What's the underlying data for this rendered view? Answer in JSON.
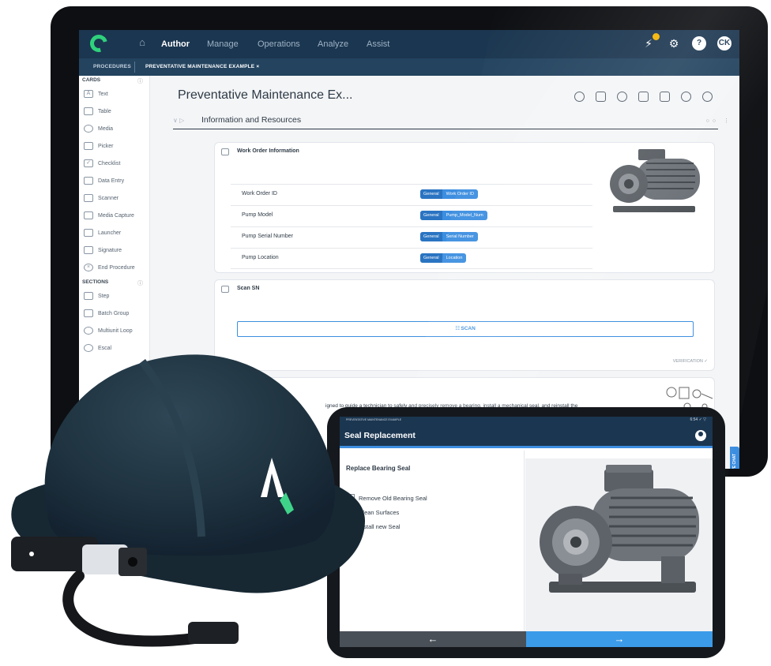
{
  "app": {
    "nav": [
      "Author",
      "Manage",
      "Operations",
      "Analyze",
      "Assist"
    ],
    "active_nav": "Author",
    "user_initials": "CK",
    "subtabs": [
      "PROCEDURES",
      "PREVENTATIVE MAINTENANCE EXAMPLE ×"
    ]
  },
  "sidebar": {
    "cards_heading": "CARDS",
    "cards": [
      "Text",
      "Table",
      "Media",
      "Picker",
      "Checklist",
      "Data Entry",
      "Scanner",
      "Media Capture",
      "Launcher",
      "Signature",
      "End Procedure"
    ],
    "sections_heading": "SECTIONS",
    "sections": [
      "Step",
      "Batch Group",
      "Multiunit Loop",
      "Escal"
    ]
  },
  "document": {
    "title": "Preventative Maintenance Ex...",
    "section_title": "Information and Resources",
    "work_order_card": {
      "title": "Work Order Information",
      "rows": [
        {
          "label": "Work Order ID",
          "chip_group": "General",
          "chip_value": "Work Order ID"
        },
        {
          "label": "Pump Model",
          "chip_group": "General",
          "chip_value": "Pump_Model_Num"
        },
        {
          "label": "Pump Serial Number",
          "chip_group": "General",
          "chip_value": "Serial Number"
        },
        {
          "label": "Pump Location",
          "chip_group": "General",
          "chip_value": "Location"
        }
      ]
    },
    "scan_card": {
      "title": "Scan SN",
      "button": "SCAN",
      "verification": "VERIFICATION ✓"
    },
    "description_snippet": "igned to guide a technician to safely and precisely remove a bearing, install a mechanical seal, and reinstall the",
    "live_chat": "LIVE CHAT"
  },
  "tablet": {
    "status_left": "PREVENTATIVE MAINTENANCE EXAMPLE",
    "status_right": "6:54 ✓ ▽",
    "title": "Seal Replacement",
    "step_title": "Replace Bearing Seal",
    "checklist": [
      "Remove Old Bearing Seal",
      "Clean Surfaces",
      "Install new Seal"
    ],
    "back_arrow": "←",
    "next_arrow": "→"
  },
  "colors": {
    "nav_bg": "#1b3650",
    "accent": "#3c8ee0",
    "logo_green": "#2fd17c",
    "hat": "#1f3340"
  },
  "icons": [
    "home-icon",
    "notification-icon",
    "settings-icon",
    "help-icon",
    "eye-icon",
    "export-icon",
    "undo-icon",
    "comment-icon",
    "user-icon",
    "arrow-left-icon",
    "arrow-right-icon"
  ]
}
